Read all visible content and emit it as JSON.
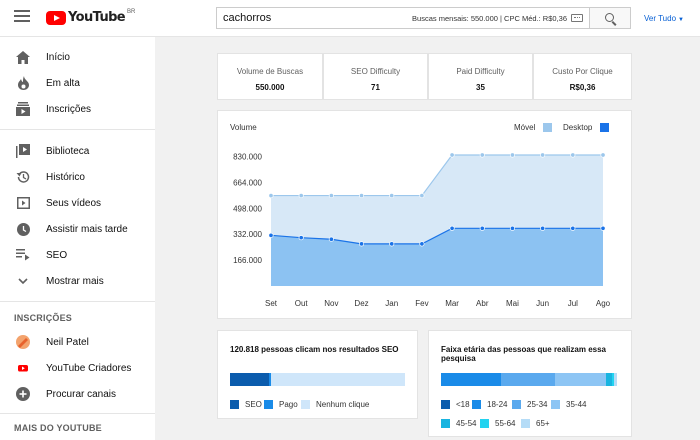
{
  "header": {
    "logo_text": "YouTube",
    "region": "BR",
    "search_value": "cachorros",
    "search_meta_label": "Buscas mensais: 550.000 | CPC Méd.: R$0,36",
    "ver_tudo": "Ver Tudo",
    "caret": "▼"
  },
  "sidebar": {
    "items": [
      {
        "label": "Início",
        "icon": "home-icon"
      },
      {
        "label": "Em alta",
        "icon": "flame-icon"
      },
      {
        "label": "Inscrições",
        "icon": "subscriptions-icon"
      },
      {
        "label": "Biblioteca",
        "icon": "library-icon"
      },
      {
        "label": "Histórico",
        "icon": "history-icon"
      },
      {
        "label": "Seus vídeos",
        "icon": "play-icon"
      },
      {
        "label": "Assistir mais tarde",
        "icon": "clock-icon"
      },
      {
        "label": "SEO",
        "icon": "playlist-icon"
      },
      {
        "label": "Mostrar mais",
        "icon": "chevron-down-icon"
      }
    ],
    "subs_title": "INSCRIÇÕES",
    "subs": [
      {
        "label": "Neil Patel"
      },
      {
        "label": "YouTube Criadores"
      },
      {
        "label": "Procurar canais"
      }
    ],
    "more_title": "MAIS DO YOUTUBE"
  },
  "metrics": [
    {
      "label": "Volume de Buscas",
      "value": "550.000"
    },
    {
      "label": "SEO Difficulty",
      "value": "71"
    },
    {
      "label": "Paid Difficulty",
      "value": "35"
    },
    {
      "label": "Custo Por Clique",
      "value": "R$0,36"
    }
  ],
  "chart_data": {
    "type": "area",
    "title": "Volume",
    "categories": [
      "Set",
      "Out",
      "Nov",
      "Dez",
      "Jan",
      "Fev",
      "Mar",
      "Abr",
      "Mai",
      "Jun",
      "Jul",
      "Ago"
    ],
    "yticks": [
      "830.000",
      "664.000",
      "498.000",
      "332.000",
      "166.000"
    ],
    "ytick_values": [
      830000,
      664000,
      498000,
      332000,
      166000
    ],
    "ylim": [
      0,
      930000
    ],
    "series": [
      {
        "name": "Móvel",
        "color": "#9cc7ec",
        "fill": "#d7e8f7",
        "values": [
          580000,
          580000,
          580000,
          580000,
          580000,
          580000,
          840000,
          840000,
          840000,
          840000,
          840000,
          840000
        ]
      },
      {
        "name": "Desktop",
        "color": "#1a73e8",
        "fill": "#8cc2f2",
        "values": [
          325000,
          310000,
          300000,
          270000,
          270000,
          270000,
          370000,
          370000,
          370000,
          370000,
          370000,
          370000
        ]
      }
    ],
    "legend_position": "top-right",
    "grid": false
  },
  "clicks": {
    "title": "120.818 pessoas clicam nos resultados SEO",
    "bar": [
      {
        "name": "SEO",
        "value": 22,
        "color": "#0b5cad"
      },
      {
        "name": "Pago",
        "value": 1.5,
        "color": "#1a8be8"
      },
      {
        "name": "Nenhum clique",
        "value": 76.5,
        "color": "#cfe6fa"
      }
    ]
  },
  "ages": {
    "title": "Faixa etária das pessoas que realizam essa pesquisa",
    "bar": [
      {
        "name": "<18",
        "value": 0,
        "color": "#0b5cad"
      },
      {
        "name": "18-24",
        "value": 34,
        "color": "#1a8be8"
      },
      {
        "name": "25-34",
        "value": 31,
        "color": "#5aa9ee"
      },
      {
        "name": "35-44",
        "value": 29,
        "color": "#8dc5f4"
      },
      {
        "name": "45-54",
        "value": 3,
        "color": "#18b4e0"
      },
      {
        "name": "55-64",
        "value": 1.5,
        "color": "#22d3f0"
      },
      {
        "name": "65+",
        "value": 1.5,
        "color": "#b5dcf7"
      }
    ]
  }
}
